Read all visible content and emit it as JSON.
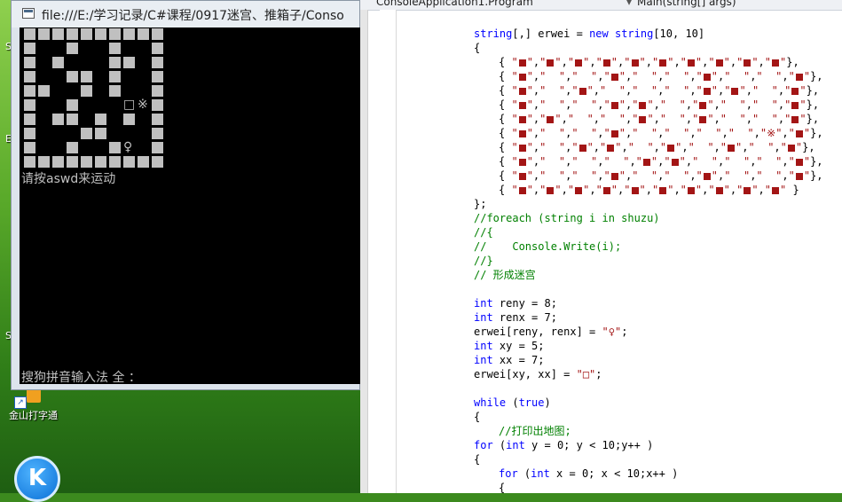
{
  "console": {
    "title": "file:///E:/学习记录/C#课程/0917迷宫、推箱子/Conso",
    "prompt": "请按aswd来运动",
    "ime": "搜狗拼音输入法 全 ：",
    "maze_rows": [
      "##########",
      "#  #  #  #",
      "# #   ## #",
      "#  ## #  #",
      "##  # #  #",
      "#  #   BX#",
      "# ## # # #",
      "#   ##   #",
      "#  #  #P #",
      "##########"
    ],
    "box_glyph": "□",
    "goal_glyph": "※",
    "player_glyph": "♀"
  },
  "desktop": {
    "shortcut_label": "金山打字通",
    "kugou_letter": "K",
    "edge_letters": [
      "S",
      "E",
      "S"
    ]
  },
  "editor": {
    "nav_left": "ConsoleApplication1.Program",
    "nav_right": "Main(string[] args)",
    "array_rows": [
      "{ \"■\",\"■\",\"■\",\"■\",\"■\",\"■\",\"■\",\"■\",\"■\",\"■\"},",
      "{ \"■\",\"  \",\"  \",\"■\",\"  \",\"  \",\"■\",\"  \",\"  \",\"■\"},",
      "{ \"■\",\"  \",\"■\",\"  \",\"  \",\"  \",\"■\",\"■\",\"  \",\"■\"},",
      "{ \"■\",\"  \",\"  \",\"■\",\"■\",\"  \",\"■\",\"  \",\"  \",\"■\"},",
      "{ \"■\",\"■\",\"  \",\"  \",\"■\",\"  \",\"■\",\"  \",\"  \",\"■\"},",
      "{ \"■\",\"  \",\"  \",\"■\",\"  \",\"  \",\"  \",\"  \",\"※\",\"■\"},",
      "{ \"■\",\"  \",\"■\",\"■\",\"  \",\"■\",\"  \",\"■\",\"  \",\"■\"},",
      "{ \"■\",\"  \",\"  \",\"  \",\"■\",\"■\",\"  \",\"  \",\"  \",\"■\"},",
      "{ \"■\",\"  \",\"  \",\"■\",\"  \",\"  \",\"■\",\"  \",\"  \",\"■\"},",
      "{ \"■\",\"■\",\"■\",\"■\",\"■\",\"■\",\"■\",\"■\",\"■\",\"■\" }"
    ],
    "lines": [
      {
        "indent": 2,
        "parts": [
          [
            "kw",
            "string"
          ],
          [
            "",
            "[,] erwei = "
          ],
          [
            "kw",
            "new"
          ],
          [
            "",
            ""
          ],
          [
            "kw",
            " string"
          ],
          [
            "",
            "[10, 10]"
          ]
        ]
      },
      {
        "indent": 2,
        "parts": [
          [
            "",
            "{"
          ]
        ]
      },
      {
        "indent": 2,
        "parts": [
          [
            "",
            "};"
          ]
        ]
      },
      {
        "indent": 2,
        "parts": [
          [
            "cm",
            "//foreach (string i in shuzu)"
          ]
        ]
      },
      {
        "indent": 2,
        "parts": [
          [
            "cm",
            "//{"
          ]
        ]
      },
      {
        "indent": 2,
        "parts": [
          [
            "cm",
            "//    Console.Write(i);"
          ]
        ]
      },
      {
        "indent": 2,
        "parts": [
          [
            "cm",
            "//}"
          ]
        ]
      },
      {
        "indent": 2,
        "parts": [
          [
            "cm",
            "// 形成迷宫"
          ]
        ]
      },
      {
        "indent": 2,
        "parts": [
          [
            "kw",
            "int"
          ],
          [
            "",
            " reny = 8;"
          ]
        ]
      },
      {
        "indent": 2,
        "parts": [
          [
            "kw",
            "int"
          ],
          [
            "",
            " renx = 7;"
          ]
        ]
      },
      {
        "indent": 2,
        "parts": [
          [
            "",
            "erwei[reny, renx] = "
          ],
          [
            "st",
            "\"♀\""
          ],
          [
            "",
            ";"
          ]
        ]
      },
      {
        "indent": 2,
        "parts": [
          [
            "kw",
            "int"
          ],
          [
            "",
            " xy = 5;"
          ]
        ]
      },
      {
        "indent": 2,
        "parts": [
          [
            "kw",
            "int"
          ],
          [
            "",
            " xx = 7;"
          ]
        ]
      },
      {
        "indent": 2,
        "parts": [
          [
            "",
            "erwei[xy, xx] = "
          ],
          [
            "st",
            "\"□\""
          ],
          [
            "",
            ";"
          ]
        ]
      },
      {
        "indent": 2,
        "parts": [
          [
            "kw",
            "while"
          ],
          [
            "",
            " ("
          ],
          [
            "kw",
            "true"
          ],
          [
            "",
            ")"
          ]
        ]
      },
      {
        "indent": 2,
        "parts": [
          [
            "",
            "{"
          ]
        ]
      },
      {
        "indent": 3,
        "parts": [
          [
            "cm",
            "//打印出地图;"
          ]
        ]
      },
      {
        "indent": 2,
        "parts": [
          [
            "kw",
            "for"
          ],
          [
            "",
            " ("
          ],
          [
            "kw",
            "int"
          ],
          [
            "",
            " y = 0; y < 10;y++ )"
          ]
        ]
      },
      {
        "indent": 2,
        "parts": [
          [
            "",
            "{"
          ]
        ]
      },
      {
        "indent": 3,
        "parts": [
          [
            "kw",
            "for"
          ],
          [
            "",
            " ("
          ],
          [
            "kw",
            "int"
          ],
          [
            "",
            " x = 0; x < 10;x++ )"
          ]
        ]
      },
      {
        "indent": 3,
        "parts": [
          [
            "",
            "{"
          ]
        ]
      }
    ]
  }
}
